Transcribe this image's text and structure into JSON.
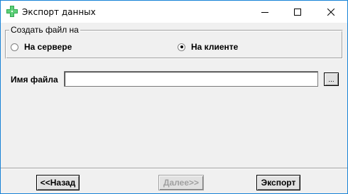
{
  "window": {
    "title": "Экспорт данных"
  },
  "group": {
    "label": "Создать файл на",
    "options": [
      {
        "label": "На сервере",
        "selected": false
      },
      {
        "label": "На клиенте",
        "selected": true
      }
    ]
  },
  "file": {
    "label": "Имя файла",
    "value": "",
    "browse_label": "..."
  },
  "buttons": {
    "back": "<<Назад",
    "next": "Далее>>",
    "export": "Экспорт"
  },
  "colors": {
    "accent": "#1883d7",
    "icon_green": "#2fa84f"
  }
}
